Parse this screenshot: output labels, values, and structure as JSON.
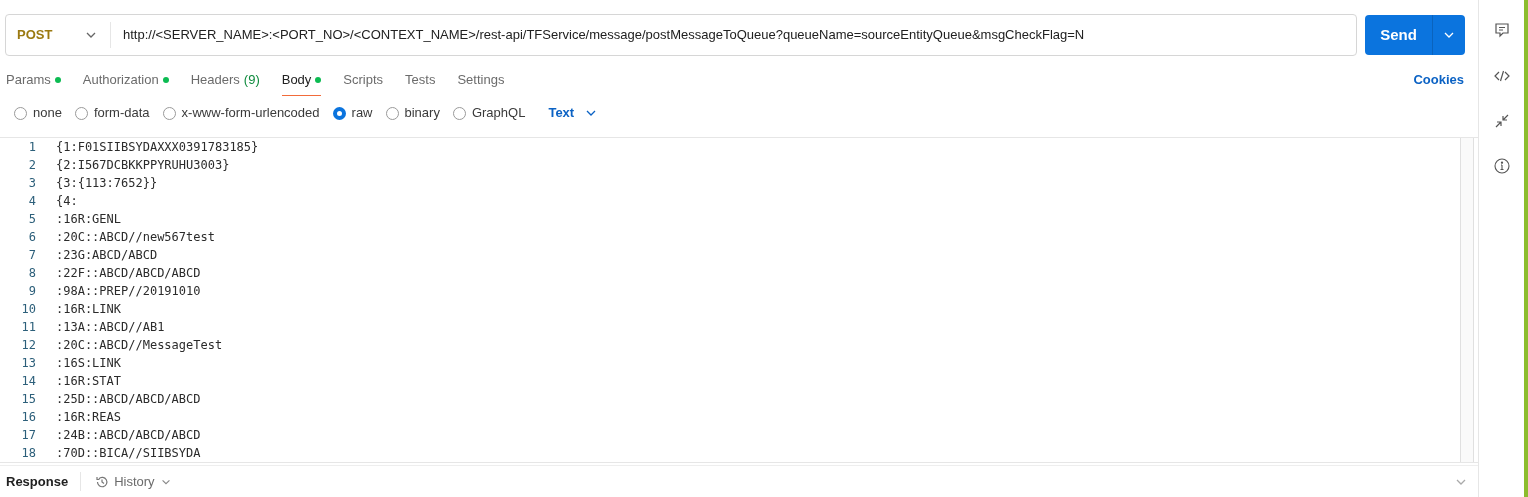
{
  "request": {
    "method": "POST",
    "url": "http://<SERVER_NAME>:<PORT_NO>/<CONTEXT_NAME>/rest-api/TFService/message/postMessageToQueue?queueName=sourceEntityQueue&msgCheckFlag=N",
    "send_label": "Send"
  },
  "tabs": [
    {
      "label": "Params",
      "dot": true,
      "selected": false
    },
    {
      "label": "Authorization",
      "dot": true,
      "selected": false
    },
    {
      "label": "Headers",
      "count": "(9)",
      "dot": false,
      "selected": false
    },
    {
      "label": "Body",
      "dot": true,
      "selected": true
    },
    {
      "label": "Scripts",
      "dot": false,
      "selected": false
    },
    {
      "label": "Tests",
      "dot": false,
      "selected": false
    },
    {
      "label": "Settings",
      "dot": false,
      "selected": false
    }
  ],
  "cookies_link": "Cookies",
  "body_types": [
    {
      "label": "none",
      "selected": false
    },
    {
      "label": "form-data",
      "selected": false
    },
    {
      "label": "x-www-form-urlencoded",
      "selected": false
    },
    {
      "label": "raw",
      "selected": true
    },
    {
      "label": "binary",
      "selected": false
    },
    {
      "label": "GraphQL",
      "selected": false
    }
  ],
  "raw_format": "Text",
  "editor": {
    "lines": [
      {
        "number": "1",
        "text": "{1:F01SIIBSYDAXXX0391783185}"
      },
      {
        "number": "2",
        "text": "{2:I567DCBKKPPYRUHU3003}"
      },
      {
        "number": "3",
        "text": "{3:{113:7652}}"
      },
      {
        "number": "4",
        "text": "{4:"
      },
      {
        "number": "5",
        "text": ":16R:GENL"
      },
      {
        "number": "6",
        "text": ":20C::ABCD//new567test"
      },
      {
        "number": "7",
        "text": ":23G:ABCD/ABCD"
      },
      {
        "number": "8",
        "text": ":22F::ABCD/ABCD/ABCD"
      },
      {
        "number": "9",
        "text": ":98A::PREP//20191010"
      },
      {
        "number": "10",
        "text": ":16R:LINK"
      },
      {
        "number": "11",
        "text": ":13A::ABCD//AB1"
      },
      {
        "number": "12",
        "text": ":20C::ABCD//MessageTest"
      },
      {
        "number": "13",
        "text": ":16S:LINK"
      },
      {
        "number": "14",
        "text": ":16R:STAT"
      },
      {
        "number": "15",
        "text": ":25D::ABCD/ABCD/ABCD"
      },
      {
        "number": "16",
        "text": ":16R:REAS"
      },
      {
        "number": "17",
        "text": ":24B::ABCD/ABCD/ABCD"
      },
      {
        "number": "18",
        "text": ":70D::BICA//SIIBSYDA"
      }
    ]
  },
  "response_bar": {
    "response_label": "Response",
    "history_label": "History"
  }
}
